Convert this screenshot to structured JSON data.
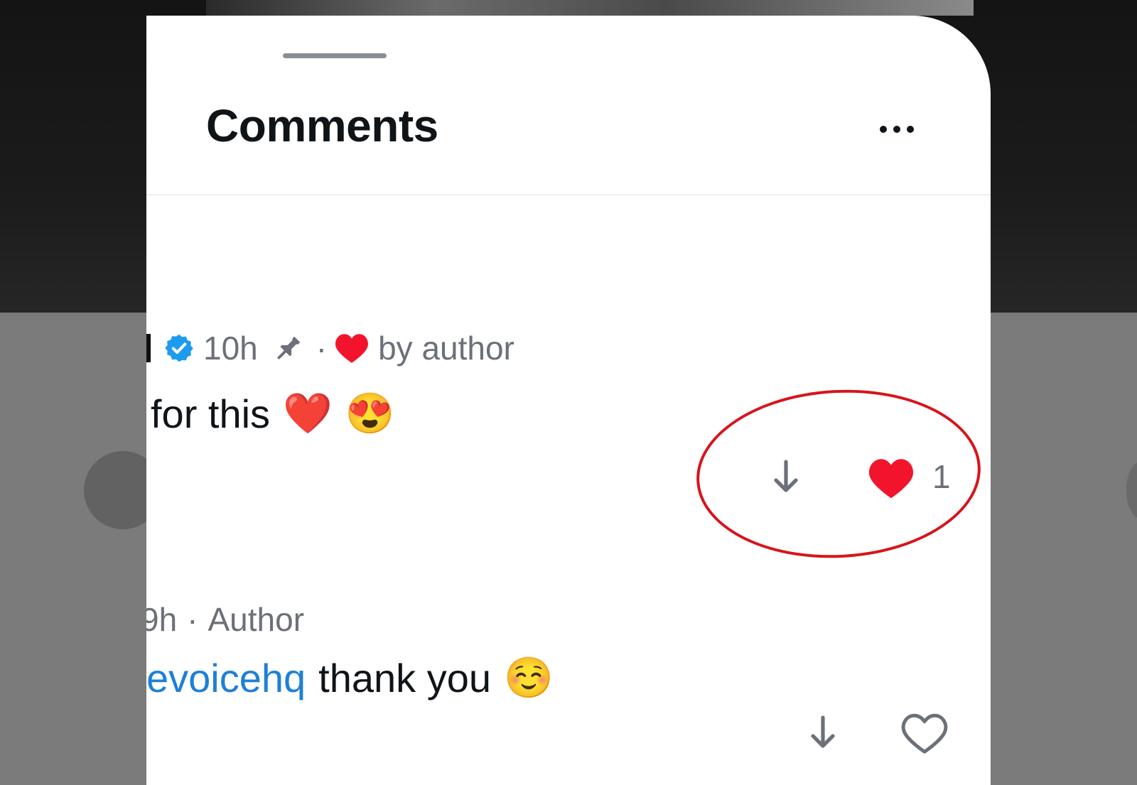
{
  "sheet": {
    "title": "Comments",
    "more_icon": "ellipsis-icon"
  },
  "comments": [
    {
      "time": "10h",
      "pinned_icon": "pin-icon",
      "separator": "·",
      "liked_by": "by author",
      "text": "for this",
      "emojis": [
        "❤️",
        "😍"
      ],
      "like_count": "1",
      "liked": true
    },
    {
      "time": "9h",
      "separator": "·",
      "role": "Author",
      "mention": "evoicehq",
      "text": "thank you",
      "emoji": "☺️",
      "liked": false
    }
  ],
  "annotation": {
    "shape": "ellipse",
    "color": "#d7141c"
  },
  "colors": {
    "heart": "#f2142c",
    "verified": "#1d9bf0",
    "mention": "#1d80d6",
    "secondary_text": "#6b7079"
  }
}
